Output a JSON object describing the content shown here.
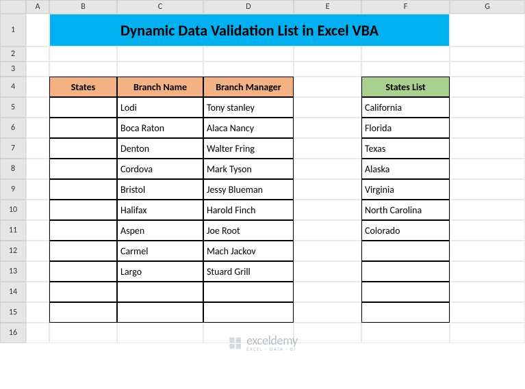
{
  "columns": [
    "A",
    "B",
    "C",
    "D",
    "E",
    "F",
    "G"
  ],
  "rows": [
    "1",
    "2",
    "3",
    "4",
    "5",
    "6",
    "7",
    "8",
    "9",
    "10",
    "11",
    "12",
    "13",
    "14",
    "15",
    "16"
  ],
  "title": "Dynamic Data Validation List in Excel VBA",
  "table1": {
    "headers": [
      "States",
      "Branch Name",
      "Branch Manager"
    ],
    "data": [
      [
        "",
        "Lodi",
        "Tony stanley"
      ],
      [
        "",
        "Boca Raton",
        "Alaca Nancy"
      ],
      [
        "",
        "Denton",
        "Walter Fring"
      ],
      [
        "",
        "Cordova",
        "Mark Tyson"
      ],
      [
        "",
        "Bristol",
        "Jessy Blueman"
      ],
      [
        "",
        "Halifax",
        "Harold Finch"
      ],
      [
        "",
        "Aspen",
        "Joe Root"
      ],
      [
        "",
        "Carmel",
        "Mach Jackov"
      ],
      [
        "",
        "Largo",
        "Stuard Grill"
      ],
      [
        "",
        "",
        ""
      ],
      [
        "",
        "",
        ""
      ]
    ]
  },
  "table2": {
    "header": "States List",
    "data": [
      "California",
      "Florida",
      "Texas",
      "Alaska",
      "Virginia",
      "North Carolina",
      "Colorado",
      "",
      "",
      "",
      ""
    ]
  },
  "watermark": {
    "main": "exceldemy",
    "sub": "EXCEL · DATA · BI"
  }
}
